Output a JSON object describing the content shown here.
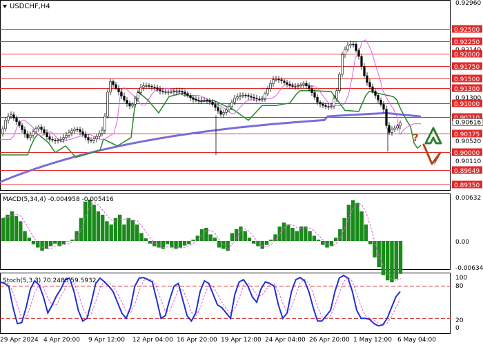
{
  "header": {
    "symbol": "USDCHF,H4",
    "menu_icon": "triangle-down-icon"
  },
  "price_axis": {
    "ticks": [
      "0.92960",
      "0.92140",
      "0.91300",
      "0.90520",
      "0.90110"
    ]
  },
  "levels": [
    {
      "label": "0.92500",
      "value": 0.925
    },
    {
      "label": "0.92250",
      "value": 0.9225
    },
    {
      "label": "0.92000",
      "value": 0.92
    },
    {
      "label": "0.91750",
      "value": 0.9175
    },
    {
      "label": "0.91500",
      "value": 0.915
    },
    {
      "label": "0.91300",
      "value": 0.913
    },
    {
      "label": "0.91000",
      "value": 0.91
    },
    {
      "label": "0.90710",
      "value": 0.9071
    },
    {
      "label": "0.90375",
      "value": 0.90375
    },
    {
      "label": "0.90000",
      "value": 0.9
    },
    {
      "label": "0.89649",
      "value": 0.89649
    },
    {
      "label": "0.89350",
      "value": 0.8935
    }
  ],
  "current_price": {
    "label": "0.90616",
    "value": 0.90616
  },
  "indicators": {
    "macd": {
      "legend": "MACD(5,34,4) -0.004958 -0.005416",
      "ticks": [
        "0.00632",
        "0.00",
        "-0.006349"
      ],
      "values": [
        0.0035,
        0.004,
        0.0045,
        0.0038,
        0.003,
        0.0015,
        0.0005,
        -0.0005,
        -0.001,
        -0.0015,
        -0.0012,
        -0.0008,
        -0.0004,
        -0.0008,
        -0.0005,
        0,
        0.0002,
        0.0015,
        0.0035,
        0.006,
        0.0063,
        0.0055,
        0.0045,
        0.004,
        0.003,
        0.0025,
        0.0035,
        0.004,
        0.0025,
        0.0035,
        0.0032,
        0.0025,
        0.0012,
        0.0004,
        -0.0004,
        -0.0008,
        -0.001,
        -0.0012,
        -0.0005,
        -0.001,
        -0.0012,
        -0.001,
        -0.0007,
        -0.0005,
        0.0002,
        0.0008,
        0.0018,
        0.002,
        0.001,
        0.0005,
        -0.001,
        -0.0012,
        -0.0015,
        0.0012,
        0.0018,
        0.0022,
        0.0015,
        0.0005,
        -0.0004,
        -0.0008,
        -0.0012,
        -0.0006,
        0.0002,
        0.001,
        0.0022,
        0.0028,
        0.0025,
        0.002,
        0.0015,
        0.0022,
        0.0022,
        0.0015,
        0.0008,
        0.0002,
        -0.0006,
        -0.001,
        -0.0008,
        0.0005,
        0.0018,
        0.0035,
        0.0055,
        0.0062,
        0.0058,
        0.0045,
        0.0025,
        -0.0005,
        -0.0025,
        -0.004,
        -0.0052,
        -0.006,
        -0.0063,
        -0.0058,
        -0.005
      ]
    },
    "stoch": {
      "legend": "Stoch(5,3,3) 70.2488 59.5932",
      "ticks": [
        "100",
        "80",
        "20",
        "0"
      ],
      "levels": [
        80,
        20
      ],
      "main": [
        88,
        85,
        80,
        40,
        10,
        12,
        40,
        75,
        90,
        82,
        60,
        30,
        45,
        62,
        75,
        92,
        95,
        70,
        35,
        15,
        20,
        50,
        85,
        95,
        88,
        80,
        70,
        50,
        30,
        20,
        40,
        80,
        95,
        96,
        92,
        88,
        55,
        20,
        25,
        55,
        80,
        85,
        55,
        25,
        15,
        30,
        70,
        90,
        85,
        65,
        45,
        40,
        30,
        20,
        65,
        88,
        92,
        80,
        60,
        50,
        75,
        88,
        85,
        80,
        45,
        20,
        30,
        70,
        92,
        96,
        90,
        70,
        40,
        15,
        15,
        25,
        35,
        70,
        95,
        100,
        95,
        70,
        35,
        20,
        20,
        18,
        10,
        6,
        8,
        20,
        40,
        60,
        70
      ]
    }
  },
  "time_axis": [
    "29 Apr 2024",
    "4 Apr 20:00",
    "9 Apr 12:00",
    "12 Apr 04:00",
    "16 Apr 20:00",
    "19 Apr 12:00",
    "24 Apr 04:00",
    "26 Apr 20:00",
    "1 May 12:00",
    "6 May 04:00"
  ],
  "annotations": {
    "question_mark": "?",
    "up_arrow": "up-arrow-icon",
    "down_arrow": "down-arrow-icon"
  },
  "colors": {
    "level_line": "#e02b2b",
    "level_label_bg": "#e02b2b",
    "ma_slow": "#7b6cd9",
    "ma_mid": "#2f8a2f",
    "ma_fast": "#e05be0",
    "macd_bar": "#1a8a1a",
    "macd_signal": "#e05be0",
    "stoch_main": "#1f2fd0",
    "stoch_signal": "#e05be0",
    "arrow_up": "#2e7d32",
    "arrow_down": "#b5451b"
  }
}
